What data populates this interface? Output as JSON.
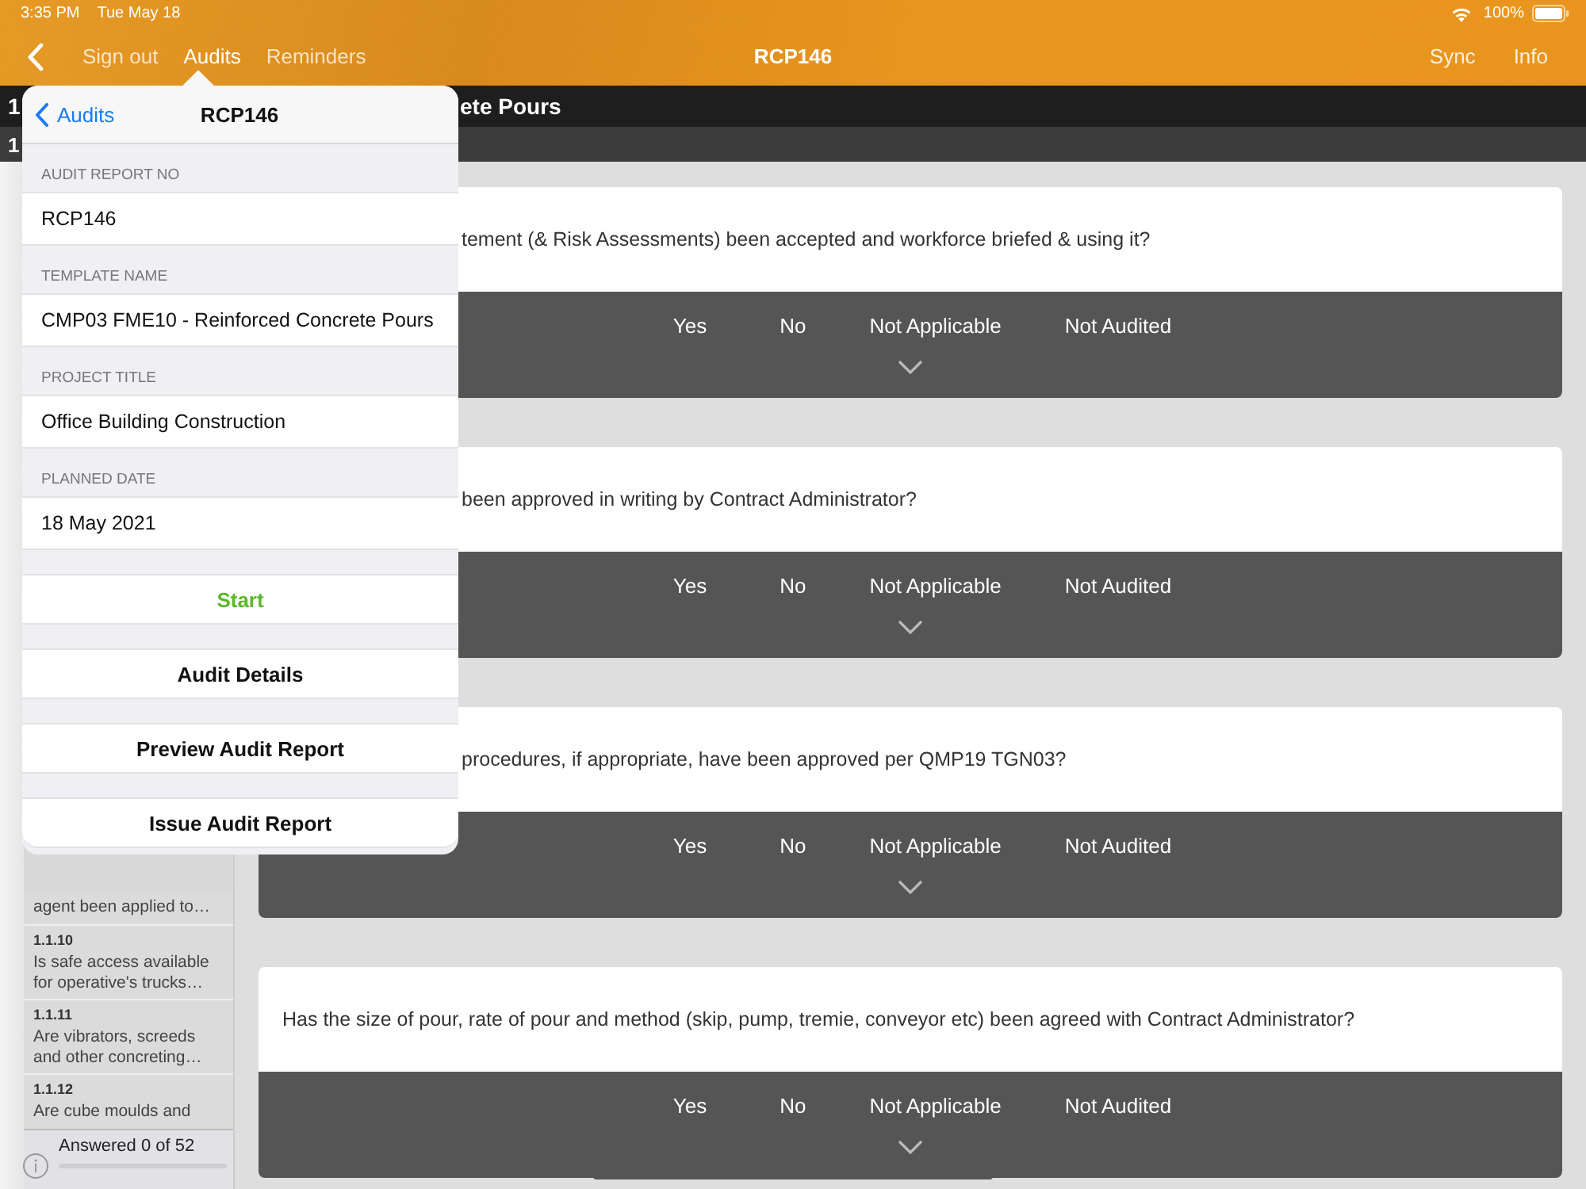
{
  "status_bar": {
    "time": "3:35 PM",
    "date": "Tue May 18",
    "battery": "100%"
  },
  "nav_bar": {
    "links": [
      {
        "label": "Sign out",
        "selected": false
      },
      {
        "label": "Audits",
        "selected": true
      },
      {
        "label": "Reminders",
        "selected": false
      }
    ],
    "title": "RCP146",
    "actions": [
      "Sync",
      "Info"
    ]
  },
  "section_header": {
    "number": "1",
    "title_visible": "ete Pours"
  },
  "subsection_header": {
    "number": "1"
  },
  "sidebar": {
    "items": [
      {
        "text": "agent been applied to…"
      },
      {
        "number": "1.1.10",
        "text": "Is safe access available for operative's trucks…"
      },
      {
        "number": "1.1.11",
        "text": "Are vibrators, screeds and other concreting…"
      },
      {
        "number": "1.1.12",
        "text": "Are cube moulds and"
      }
    ],
    "footer": {
      "text": "Answered 0 of 52",
      "level": 0
    }
  },
  "questions": [
    {
      "text": "tement (& Risk Assessments) been accepted and workforce briefed & using it?",
      "options": [
        {
          "label": "Yes",
          "selected": false
        },
        {
          "label": "No",
          "selected": false
        },
        {
          "label": "Not Applicable",
          "selected": false
        },
        {
          "label": "Not Audited",
          "selected": false
        }
      ]
    },
    {
      "text": "been approved in writing by Contract Administrator?",
      "options": [
        {
          "label": "Yes",
          "selected": false
        },
        {
          "label": "No",
          "selected": false
        },
        {
          "label": "Not Applicable",
          "selected": false
        },
        {
          "label": "Not Audited",
          "selected": false
        }
      ]
    },
    {
      "text": "procedures, if appropriate, have been approved per QMP19 TGN03?",
      "options": [
        {
          "label": "Yes",
          "selected": false
        },
        {
          "label": "No",
          "selected": false
        },
        {
          "label": "Not Applicable",
          "selected": false
        },
        {
          "label": "Not Audited",
          "selected": false
        }
      ]
    },
    {
      "text": "Has the size of pour, rate of pour and method (skip, pump, tremie, conveyor etc) been agreed with Contract Administrator?",
      "options": [
        {
          "label": "Yes",
          "selected": false
        },
        {
          "label": "No",
          "selected": false
        },
        {
          "label": "Not Applicable",
          "selected": false
        },
        {
          "label": "Not Audited",
          "selected": false
        }
      ]
    }
  ],
  "popover": {
    "back": "Audits",
    "title": "RCP146",
    "fields": [
      {
        "label": "AUDIT REPORT NO",
        "value": "RCP146"
      },
      {
        "label": "TEMPLATE NAME",
        "value": "CMP03 FME10 - Reinforced Concrete Pours"
      },
      {
        "label": "PROJECT TITLE",
        "value": "Office Building Construction"
      },
      {
        "label": "PLANNED DATE",
        "value": "18 May 2021"
      }
    ],
    "actions": [
      {
        "label": "Start",
        "kind": "primary"
      },
      {
        "label": "Audit Details",
        "kind": "default"
      },
      {
        "label": "Preview Audit Report",
        "kind": "default"
      },
      {
        "label": "Issue Audit Report",
        "kind": "default"
      }
    ]
  }
}
